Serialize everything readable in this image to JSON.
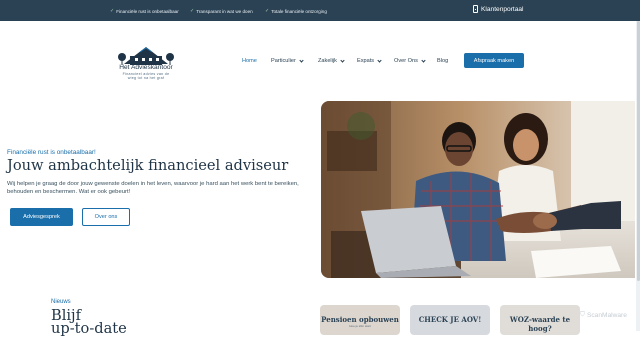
{
  "topbar": {
    "usps": [
      "Financiële rust is onbetaalbaar",
      "Transparant in wat we doen",
      "Totale financiële ontzorging"
    ],
    "portal_label": "Klantenportaal",
    "portal_icon": "phone-icon"
  },
  "logo": {
    "title": "Het Advieskantoor",
    "tagline": "Financieel advies van de wieg tot na het graf"
  },
  "nav": {
    "items": [
      {
        "label": "Home",
        "active": true,
        "dropdown": false
      },
      {
        "label": "Particulier",
        "active": false,
        "dropdown": true
      },
      {
        "label": "Zakelijk",
        "active": false,
        "dropdown": true
      },
      {
        "label": "Expats",
        "active": false,
        "dropdown": true
      },
      {
        "label": "Over Ons",
        "active": false,
        "dropdown": true
      },
      {
        "label": "Blog",
        "active": false,
        "dropdown": false
      }
    ],
    "cta_label": "Afspraak maken"
  },
  "hero": {
    "eyebrow": "Financiële rust is onbetaalbaar!",
    "title": "Jouw ambachtelijk financieel adviseur",
    "lead": "Wij helpen je graag de door jouw gewenste doelen in het leven, waarvoor je hard aan het werk bent te bereiken, behouden en beschermen. Wat er ook gebeurt!",
    "primary_button": "Adviesgesprek",
    "secondary_button": "Over ons"
  },
  "news": {
    "label": "Nieuws",
    "title_line1": "Blijf",
    "title_line2": "up-to-date",
    "cards": [
      {
        "title": "Pensioen opbouwen",
        "subtitle": "Hoe je slim start"
      },
      {
        "title": "CHECK JE AOV!",
        "subtitle": ""
      },
      {
        "title": "WOZ-waarde te hoog?",
        "subtitle": ""
      }
    ]
  },
  "watermark": "ScanMalware",
  "colors": {
    "topbar": "#2b4254",
    "accent": "#1a6eaa",
    "heading": "#1f3446"
  }
}
